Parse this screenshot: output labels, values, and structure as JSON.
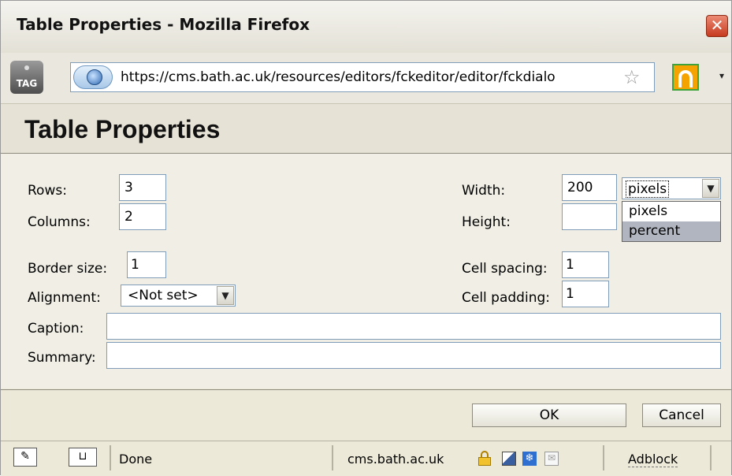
{
  "window": {
    "title": "Table Properties - Mozilla Firefox",
    "close_glyph": "✕"
  },
  "addressbar": {
    "tag_label": "TAG",
    "url": "https://cms.bath.ac.uk/resources/editors/fckeditor/editor/fckdialo",
    "star_glyph": "☆",
    "menu_glyph": "▾"
  },
  "dialog": {
    "heading": "Table Properties",
    "rows_label": "Rows:",
    "rows_value": "3",
    "columns_label": "Columns:",
    "columns_value": "2",
    "border_label": "Border size:",
    "border_value": "1",
    "alignment_label": "Alignment:",
    "alignment_value": "<Not set>",
    "width_label": "Width:",
    "width_value": "200",
    "width_unit": "pixels",
    "width_unit_options": [
      "pixels",
      "percent"
    ],
    "width_unit_highlighted": "percent",
    "height_label": "Height:",
    "height_value": "",
    "cellspacing_label": "Cell spacing:",
    "cellspacing_value": "1",
    "cellpadding_label": "Cell padding:",
    "cellpadding_value": "1",
    "caption_label": "Caption:",
    "caption_value": "",
    "summary_label": "Summary:",
    "summary_value": "",
    "ok_label": "OK",
    "cancel_label": "Cancel",
    "arrow_glyph": "▼"
  },
  "statusbar": {
    "status": "Done",
    "domain": "cms.bath.ac.uk",
    "adblock": "Adblock"
  },
  "colors": {
    "selection": "#b0b5bf",
    "input_border": "#7f9db9",
    "dialog_bg": "#f1efe5"
  }
}
